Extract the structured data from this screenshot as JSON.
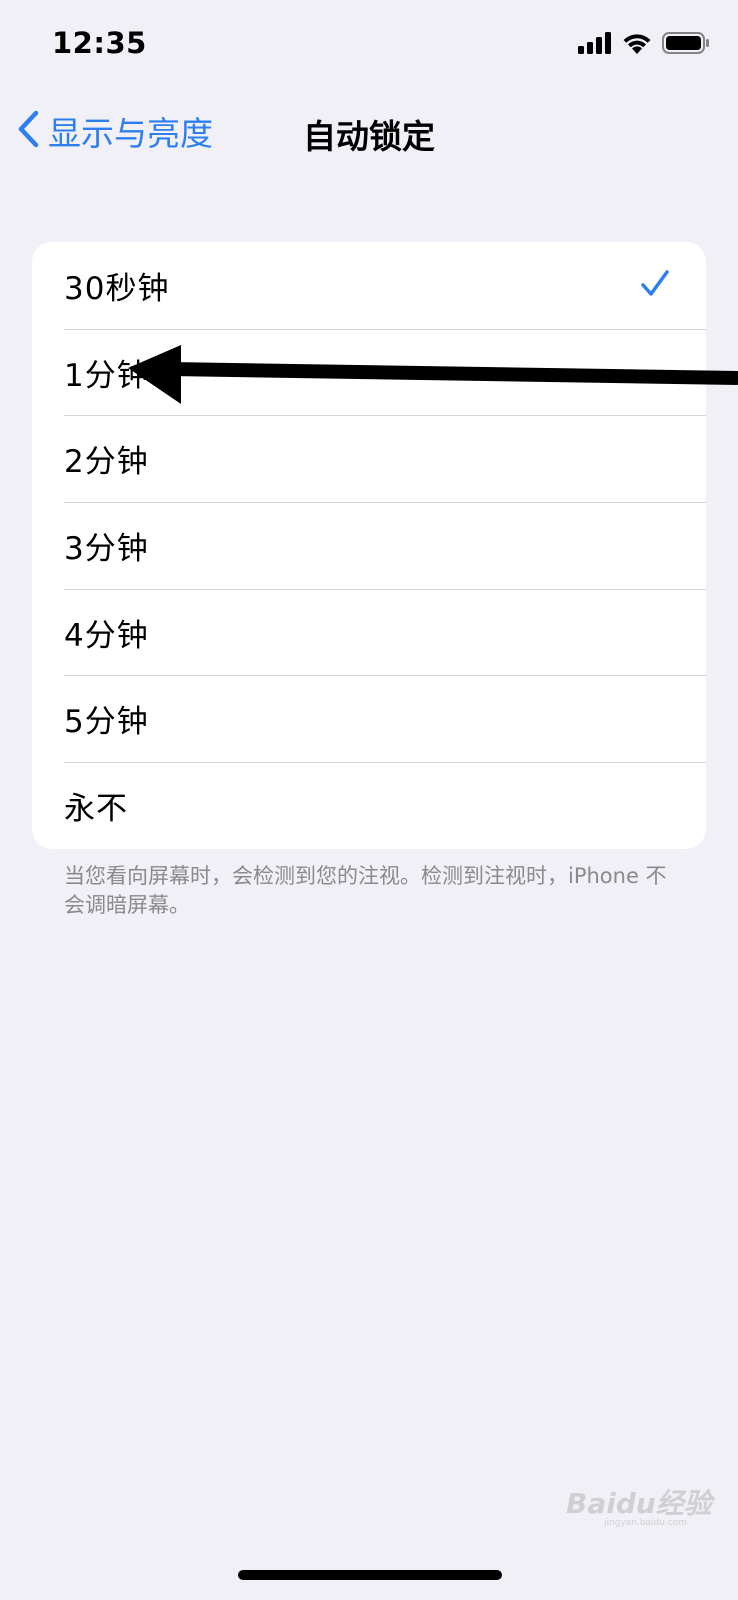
{
  "status_bar": {
    "time": "12:35",
    "signal_icon": "cellular-signal-icon",
    "wifi_icon": "wifi-icon",
    "battery_icon": "battery-icon"
  },
  "nav": {
    "back_label": "显示与亮度",
    "back_icon": "chevron-left-icon",
    "title": "自动锁定"
  },
  "options": [
    {
      "label": "30秒钟",
      "selected": true
    },
    {
      "label": "1分钟",
      "selected": false
    },
    {
      "label": "2分钟",
      "selected": false
    },
    {
      "label": "3分钟",
      "selected": false
    },
    {
      "label": "4分钟",
      "selected": false
    },
    {
      "label": "5分钟",
      "selected": false
    },
    {
      "label": "永不",
      "selected": false
    }
  ],
  "footnote": "当您看向屏幕时，会检测到您的注视。检测到注视时，iPhone 不会调暗屏幕。",
  "annotation": {
    "icon": "arrow-annotation-icon",
    "target": "1分钟"
  },
  "watermark": {
    "text": "Baidu经验",
    "sub": "jingyan.baidu.com"
  },
  "colors": {
    "accent": "#2d7ff0",
    "background": "#f0f0f6",
    "card": "#ffffff",
    "separator": "#d4d4d8",
    "secondary_text": "#8a8a8e"
  }
}
